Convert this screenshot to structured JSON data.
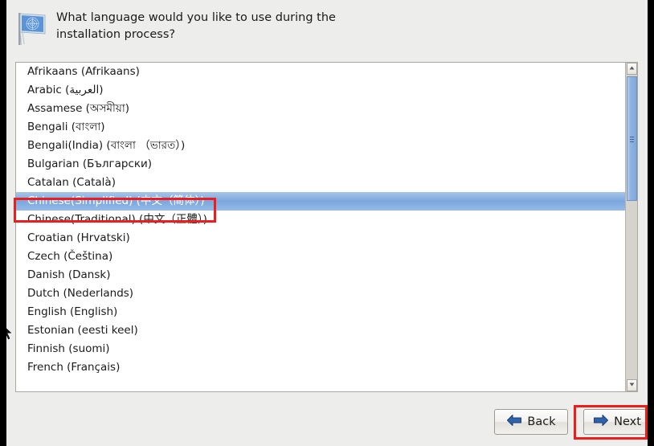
{
  "window": {
    "background_color": "#ededeb",
    "edge_color": "#000000"
  },
  "header": {
    "icon": "un-flag-icon",
    "prompt": "What language would you like to use during the\ninstallation process?"
  },
  "language_list": {
    "selected_index": 6,
    "selected_value": "Chinese(Simplified) (中文（简体）)",
    "highlight_color": "#7ba7de",
    "items": [
      {
        "label": "Afrikaans (Afrikaans)"
      },
      {
        "label": "Arabic (العربية)"
      },
      {
        "label": "Assamese (অসমীয়া)"
      },
      {
        "label": "Bengali (বাংলা)"
      },
      {
        "label": "Bengali(India) (বাংলা （ভারত）)"
      },
      {
        "label": "Bulgarian (Български)"
      },
      {
        "label": "Catalan (Català)"
      },
      {
        "label": "Chinese(Simplified) (中文（简体）)"
      },
      {
        "label": "Chinese(Traditional) (中文（正體）)"
      },
      {
        "label": "Croatian (Hrvatski)"
      },
      {
        "label": "Czech (Čeština)"
      },
      {
        "label": "Danish (Dansk)"
      },
      {
        "label": "Dutch (Nederlands)"
      },
      {
        "label": "English (English)"
      },
      {
        "label": "Estonian (eesti keel)"
      },
      {
        "label": "Finnish (suomi)"
      },
      {
        "label": "French (Français)"
      }
    ]
  },
  "scrollbar": {
    "up_arrow_icon": "chevron-up-icon",
    "down_arrow_icon": "chevron-down-icon",
    "orientation": "vertical"
  },
  "footer": {
    "back_button": {
      "label": "Back",
      "icon": "arrow-left-icon"
    },
    "next_button": {
      "label": "Next",
      "icon": "arrow-right-icon"
    }
  },
  "annotations": {
    "color": "#ee1c1c",
    "selected_language_box": "Chinese(Simplified) (中文（简体）)",
    "next_button_box": "Next"
  },
  "cursor": {
    "icon": "mouse-pointer-icon"
  }
}
